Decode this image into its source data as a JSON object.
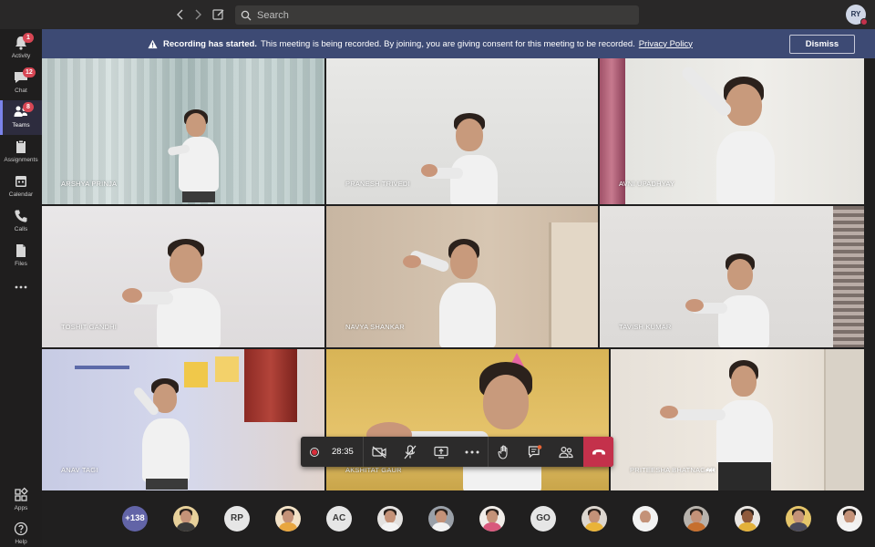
{
  "topbar": {
    "search_placeholder": "Search",
    "user_initials": "RY"
  },
  "rail": {
    "items": [
      {
        "label": "Activity",
        "badge": "1",
        "icon": "bell-icon"
      },
      {
        "label": "Chat",
        "badge": "12",
        "icon": "chat-icon"
      },
      {
        "label": "Teams",
        "badge": "8",
        "icon": "teams-icon"
      },
      {
        "label": "Assignments",
        "badge": "",
        "icon": "assignments-icon"
      },
      {
        "label": "Calendar",
        "badge": "",
        "icon": "calendar-icon"
      },
      {
        "label": "Calls",
        "badge": "",
        "icon": "phone-icon"
      },
      {
        "label": "Files",
        "badge": "",
        "icon": "file-icon"
      }
    ],
    "apps_label": "Apps",
    "help_label": "Help"
  },
  "banner": {
    "title": "Recording has started.",
    "message": "This meeting is being recorded. By joining, you are giving consent for this meeting to be recorded.",
    "link": "Privacy Policy",
    "dismiss_label": "Dismiss"
  },
  "participants": [
    {
      "name": "ARSHYA PRINJA"
    },
    {
      "name": "PRANESH TRIVEDI"
    },
    {
      "name": "AVNI UPADHYAY"
    },
    {
      "name": "TOSHIT GANDHI"
    },
    {
      "name": "NAVYA SHANKAR"
    },
    {
      "name": "TAVISH KUMAR"
    },
    {
      "name": "ANAV TAGI"
    },
    {
      "name": "AKSHITAT GAUR"
    },
    {
      "name": "PRITEESHA BHATNAGAR"
    }
  ],
  "controls": {
    "timer": "28:35"
  },
  "roster": {
    "overflow": "+138",
    "avatars": [
      {
        "kind": "photo"
      },
      {
        "kind": "initials",
        "text": "RP"
      },
      {
        "kind": "photo"
      },
      {
        "kind": "initials",
        "text": "AC"
      },
      {
        "kind": "photo"
      },
      {
        "kind": "photo"
      },
      {
        "kind": "photo"
      },
      {
        "kind": "initials",
        "text": "GO"
      },
      {
        "kind": "photo"
      },
      {
        "kind": "photo"
      },
      {
        "kind": "photo"
      },
      {
        "kind": "photo"
      },
      {
        "kind": "photo"
      },
      {
        "kind": "photo"
      }
    ]
  },
  "colors": {
    "banner": "#3d4a74",
    "hangup": "#c4314b",
    "accent": "#6264a7",
    "badge": "#d74654"
  }
}
